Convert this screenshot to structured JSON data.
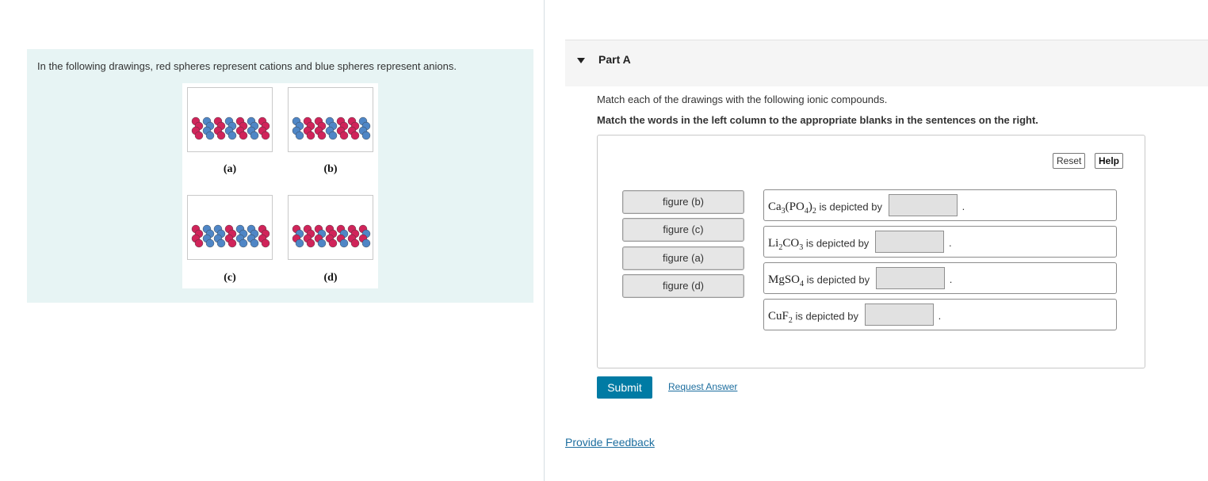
{
  "intro": {
    "text": "In the following drawings, red spheres represent cations and blue spheres represent anions.",
    "figures": [
      {
        "caption": "(a)"
      },
      {
        "caption": "(b)"
      },
      {
        "caption": "(c)"
      },
      {
        "caption": "(d)"
      }
    ],
    "colors": {
      "cation": "#d0245a",
      "anion": "#4f86c6"
    }
  },
  "part": {
    "title": "Part A",
    "instruction": "Match each of the drawings with the following ionic compounds.",
    "instruction_bold": "Match the words in the left column to the appropriate blanks in the sentences on the right."
  },
  "toolbar": {
    "reset_label": "Reset",
    "help_label": "Help"
  },
  "choices": [
    {
      "label": "figure (b)"
    },
    {
      "label": "figure (c)"
    },
    {
      "label": "figure (a)"
    },
    {
      "label": "figure (d)"
    }
  ],
  "sentences": [
    {
      "text": "is depicted by",
      "end": "."
    },
    {
      "text": "is depicted by",
      "end": "."
    },
    {
      "text": "is depicted by",
      "end": "."
    },
    {
      "text": "is depicted by",
      "end": "."
    }
  ],
  "actions": {
    "submit_label": "Submit",
    "request_label": "Request Answer",
    "feedback_label": "Provide Feedback"
  },
  "accent": "#007ba4"
}
